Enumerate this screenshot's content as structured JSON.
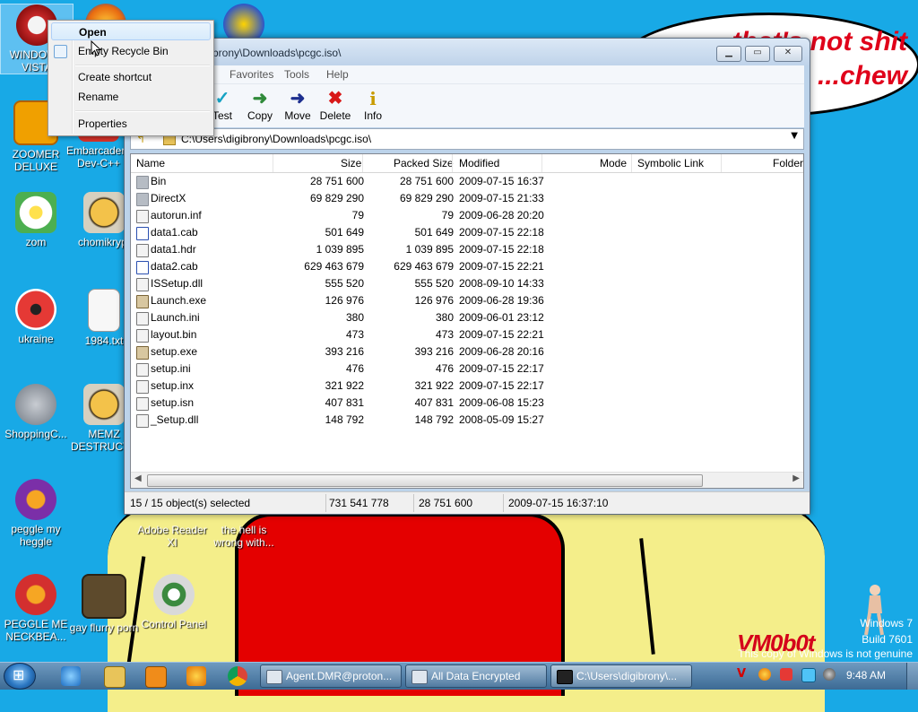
{
  "wallpaper": {
    "bubble_text": "...that's not shit\n...chew",
    "vm_logo": "VM0b0t",
    "watermark_line1": "Windows 7",
    "watermark_line2": "Build 7601",
    "watermark_line3": "This copy of Windows is not genuine"
  },
  "desktop_icons": [
    {
      "label": "WINDOWS VISTA"
    },
    {
      "label": "ZOOMER DELUXE"
    },
    {
      "label": "Embarcadero Dev-C++"
    },
    {
      "label": "zom"
    },
    {
      "label": "chomikrypt"
    },
    {
      "label": "ukraine"
    },
    {
      "label": "1984.txt"
    },
    {
      "label": "ShoppingC..."
    },
    {
      "label": "MEMZ DESTRUCT..."
    },
    {
      "label": "peggle my heggle"
    },
    {
      "label": "Adobe Reader XI"
    },
    {
      "label": "the hell is wrong with..."
    },
    {
      "label": "PEGGLE ME NECKBEA..."
    },
    {
      "label": "gay flurry porn"
    },
    {
      "label": "Control Panel"
    }
  ],
  "context_menu": {
    "items": [
      "Open",
      "Empty Recycle Bin",
      "Create shortcut",
      "Rename",
      "Properties"
    ]
  },
  "window": {
    "title": "C:\\Users\\digibrony\\Downloads\\pcgc.iso\\",
    "title_visible": "...brony\\Downloads\\pcgc.iso\\",
    "menu": [
      "Favorites",
      "Tools",
      "Help"
    ],
    "toolbar": [
      "Test",
      "Copy",
      "Move",
      "Delete",
      "Info"
    ],
    "path": "C:\\Users\\digibrony\\Downloads\\pcgc.iso\\",
    "columns": [
      "Name",
      "Size",
      "Packed Size",
      "Modified",
      "Mode",
      "Symbolic Link",
      "Folder"
    ],
    "files": [
      {
        "name": "Bin",
        "size": "28 751 600",
        "packed": "28 751 600",
        "modified": "2009-07-15 16:37",
        "icon": "folder"
      },
      {
        "name": "DirectX",
        "size": "69 829 290",
        "packed": "69 829 290",
        "modified": "2009-07-15 21:33",
        "icon": "folder"
      },
      {
        "name": "autorun.inf",
        "size": "79",
        "packed": "79",
        "modified": "2009-06-28 20:20",
        "icon": "file"
      },
      {
        "name": "data1.cab",
        "size": "501 649",
        "packed": "501 649",
        "modified": "2009-07-15 22:18",
        "icon": "cab"
      },
      {
        "name": "data1.hdr",
        "size": "1 039 895",
        "packed": "1 039 895",
        "modified": "2009-07-15 22:18",
        "icon": "file"
      },
      {
        "name": "data2.cab",
        "size": "629 463 679",
        "packed": "629 463 679",
        "modified": "2009-07-15 22:21",
        "icon": "cab"
      },
      {
        "name": "ISSetup.dll",
        "size": "555 520",
        "packed": "555 520",
        "modified": "2008-09-10 14:33",
        "icon": "file"
      },
      {
        "name": "Launch.exe",
        "size": "126 976",
        "packed": "126 976",
        "modified": "2009-06-28 19:36",
        "icon": "exe"
      },
      {
        "name": "Launch.ini",
        "size": "380",
        "packed": "380",
        "modified": "2009-06-01 23:12",
        "icon": "file"
      },
      {
        "name": "layout.bin",
        "size": "473",
        "packed": "473",
        "modified": "2009-07-15 22:21",
        "icon": "file"
      },
      {
        "name": "setup.exe",
        "size": "393 216",
        "packed": "393 216",
        "modified": "2009-06-28 20:16",
        "icon": "exe"
      },
      {
        "name": "setup.ini",
        "size": "476",
        "packed": "476",
        "modified": "2009-07-15 22:17",
        "icon": "file"
      },
      {
        "name": "setup.inx",
        "size": "321 922",
        "packed": "321 922",
        "modified": "2009-07-15 22:17",
        "icon": "file"
      },
      {
        "name": "setup.isn",
        "size": "407 831",
        "packed": "407 831",
        "modified": "2009-06-08 15:23",
        "icon": "file"
      },
      {
        "name": "_Setup.dll",
        "size": "148 792",
        "packed": "148 792",
        "modified": "2008-05-09 15:27",
        "icon": "file"
      }
    ],
    "status": {
      "selected": "15 / 15 object(s) selected",
      "total_size": "731 541 778",
      "packed_size": "28 751 600",
      "modified": "2009-07-15 16:37:10"
    }
  },
  "taskbar": {
    "tasks": [
      "Agent.DMR@proton...",
      "All Data Encrypted",
      "C:\\Users\\digibrony\\..."
    ],
    "clock": "9:48 AM"
  },
  "colors": {
    "desktop": "#18a9e6",
    "bubble_text": "#e0001a",
    "shirt": "#e40000",
    "body": "#f4ee8a"
  }
}
